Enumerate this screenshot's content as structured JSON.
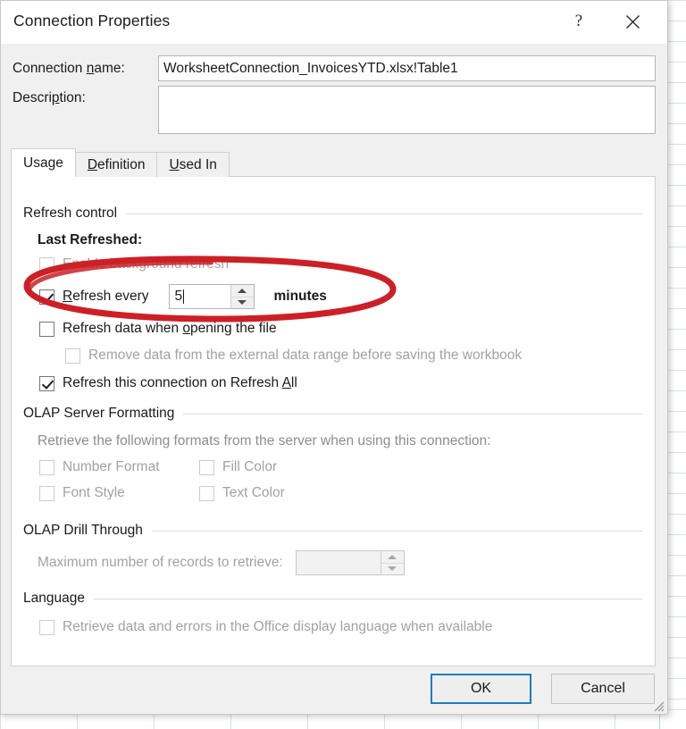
{
  "window": {
    "title": "Connection Properties",
    "help_icon": "question-mark-icon",
    "close_icon": "close-x-icon"
  },
  "fields": {
    "connection_name_label": "Connection name:",
    "connection_name_label_accel": "n",
    "connection_name_value": "WorksheetConnection_InvoicesYTD.xlsx!Table1",
    "description_label": "Description:",
    "description_value": ""
  },
  "tabs": [
    {
      "label": "Usage",
      "accel": "g",
      "active": true
    },
    {
      "label": "Definition",
      "accel": "D",
      "active": false
    },
    {
      "label": "Used In",
      "accel": "U",
      "active": false
    }
  ],
  "refresh_control": {
    "group_title": "Refresh control",
    "last_refreshed_label": "Last Refreshed:",
    "enable_background_refresh": {
      "label": "Enable background refresh",
      "checked": false,
      "enabled": false
    },
    "refresh_every": {
      "label": "Refresh every",
      "accel": "R",
      "checked": true,
      "enabled": true,
      "value": "5",
      "unit_label": "minutes"
    },
    "refresh_on_open": {
      "label": "Refresh data when opening the file",
      "accel": "o",
      "checked": false,
      "enabled": true
    },
    "remove_data": {
      "label": "Remove data from the external data range before saving the workbook",
      "checked": false,
      "enabled": false
    },
    "refresh_all": {
      "label": "Refresh this connection on Refresh All",
      "accel": "A",
      "checked": true,
      "enabled": true
    }
  },
  "olap_server_formatting": {
    "group_title": "OLAP Server Formatting",
    "description": "Retrieve the following formats from the server when using this connection:",
    "options": [
      {
        "label": "Number Format",
        "checked": false,
        "enabled": false
      },
      {
        "label": "Fill Color",
        "checked": false,
        "enabled": false
      },
      {
        "label": "Font Style",
        "checked": false,
        "enabled": false
      },
      {
        "label": "Text Color",
        "checked": false,
        "enabled": false
      }
    ]
  },
  "olap_drill_through": {
    "group_title": "OLAP Drill Through",
    "max_records_label": "Maximum number of records to retrieve:",
    "max_records_value": "",
    "enabled": false
  },
  "language": {
    "group_title": "Language",
    "retrieve_office_language": {
      "label": "Retrieve data and errors in the Office display language when available",
      "checked": false,
      "enabled": false
    }
  },
  "footer": {
    "ok_label": "OK",
    "cancel_label": "Cancel",
    "resize_grip_icon": "resize-grip-icon"
  },
  "annotation": {
    "type": "hand-drawn-ellipse",
    "color": "#cc2026",
    "target": "Refresh every 5 minutes"
  },
  "colors": {
    "dialog_background": "#f0f0f0",
    "panel_background": "#ffffff",
    "text": "#1a1a1a",
    "disabled_text": "#a2a2a2",
    "focus_border": "#1e7bc4",
    "annotation_red": "#cc2026",
    "grid_line": "#d4e2ef"
  }
}
